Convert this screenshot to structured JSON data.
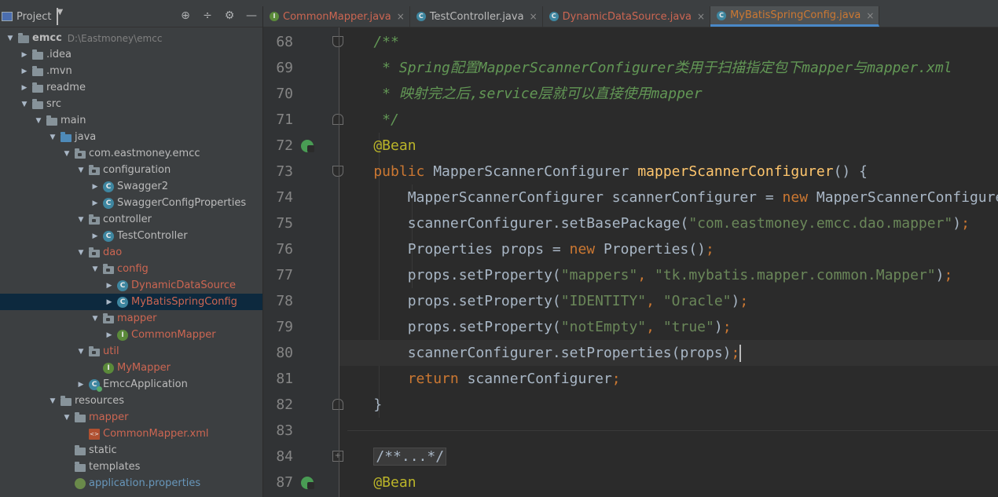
{
  "project_panel": {
    "title": "Project",
    "tree": [
      {
        "label": "emcc",
        "path": "D:\\Eastmoney\\emcc",
        "depth": 0,
        "expanded": true,
        "icon": "folder-icon",
        "kind": "root"
      },
      {
        "label": ".idea",
        "depth": 1,
        "expanded": false,
        "icon": "folder-icon"
      },
      {
        "label": ".mvn",
        "depth": 1,
        "expanded": false,
        "icon": "folder-icon"
      },
      {
        "label": "readme",
        "depth": 1,
        "expanded": false,
        "icon": "folder-icon"
      },
      {
        "label": "src",
        "depth": 1,
        "expanded": true,
        "icon": "folder-icon"
      },
      {
        "label": "main",
        "depth": 2,
        "expanded": true,
        "icon": "folder-icon"
      },
      {
        "label": "java",
        "depth": 3,
        "expanded": true,
        "icon": "source-folder-icon"
      },
      {
        "label": "com.eastmoney.emcc",
        "depth": 4,
        "expanded": true,
        "icon": "package-icon"
      },
      {
        "label": "configuration",
        "depth": 5,
        "expanded": true,
        "icon": "package-icon"
      },
      {
        "label": "Swagger2",
        "depth": 6,
        "expanded": false,
        "icon": "class-icon"
      },
      {
        "label": "SwaggerConfigProperties",
        "depth": 6,
        "expanded": false,
        "icon": "class-icon"
      },
      {
        "label": "controller",
        "depth": 5,
        "expanded": true,
        "icon": "package-icon"
      },
      {
        "label": "TestController",
        "depth": 6,
        "expanded": false,
        "icon": "class-icon"
      },
      {
        "label": "dao",
        "depth": 5,
        "expanded": true,
        "icon": "package-icon",
        "color": "red"
      },
      {
        "label": "config",
        "depth": 6,
        "expanded": true,
        "icon": "package-icon",
        "color": "red"
      },
      {
        "label": "DynamicDataSource",
        "depth": 7,
        "expanded": false,
        "icon": "class-icon",
        "color": "red"
      },
      {
        "label": "MyBatisSpringConfig",
        "depth": 7,
        "expanded": false,
        "icon": "class-icon",
        "color": "red",
        "selected": true
      },
      {
        "label": "mapper",
        "depth": 6,
        "expanded": true,
        "icon": "package-icon",
        "color": "red"
      },
      {
        "label": "CommonMapper",
        "depth": 7,
        "expanded": false,
        "icon": "interface-icon",
        "color": "red"
      },
      {
        "label": "util",
        "depth": 5,
        "expanded": true,
        "icon": "package-icon",
        "color": "red"
      },
      {
        "label": "MyMapper",
        "depth": 6,
        "expanded": null,
        "icon": "interface-icon",
        "color": "red"
      },
      {
        "label": "EmccApplication",
        "depth": 5,
        "expanded": false,
        "icon": "spring-app-icon"
      },
      {
        "label": "resources",
        "depth": 3,
        "expanded": true,
        "icon": "resources-folder-icon"
      },
      {
        "label": "mapper",
        "depth": 4,
        "expanded": true,
        "icon": "folder-icon",
        "color": "red"
      },
      {
        "label": "CommonMapper.xml",
        "depth": 5,
        "expanded": null,
        "icon": "xml-file-icon",
        "color": "red"
      },
      {
        "label": "static",
        "depth": 4,
        "expanded": null,
        "icon": "folder-icon"
      },
      {
        "label": "templates",
        "depth": 4,
        "expanded": null,
        "icon": "folder-icon"
      },
      {
        "label": "application.properties",
        "depth": 4,
        "expanded": null,
        "icon": "properties-file-icon",
        "color": "blue"
      }
    ]
  },
  "tabs": [
    {
      "label": "CommonMapper.java",
      "icon": "I",
      "color": "red",
      "active": false
    },
    {
      "label": "TestController.java",
      "icon": "C",
      "color": "default",
      "active": false
    },
    {
      "label": "DynamicDataSource.java",
      "icon": "C",
      "color": "red",
      "active": false
    },
    {
      "label": "MyBatisSpringConfig.java",
      "icon": "C",
      "color": "red",
      "active": true
    }
  ],
  "code_lines": [
    {
      "num": "68",
      "fold": "top",
      "tokens": [
        [
          "cmt",
          "    /**"
        ]
      ]
    },
    {
      "num": "69",
      "tokens": [
        [
          "cmt",
          "     * Spring配置MapperScannerConfigurer类用于扫描指定包下mapper与mapper.xml"
        ]
      ]
    },
    {
      "num": "70",
      "tokens": [
        [
          "cmt",
          "     * 映射完之后,service层就可以直接使用mapper"
        ]
      ]
    },
    {
      "num": "71",
      "fold": "bot",
      "tokens": [
        [
          "cmt",
          "     */"
        ]
      ]
    },
    {
      "num": "72",
      "marker": true,
      "tokens": [
        [
          "ann",
          "    @Bean"
        ]
      ]
    },
    {
      "num": "73",
      "fold": "top",
      "tokens": [
        [
          "kw",
          "    public "
        ],
        [
          "",
          "MapperScannerConfigurer "
        ],
        [
          "fn",
          "mapperScannerConfigurer"
        ],
        [
          "",
          "() {"
        ]
      ]
    },
    {
      "num": "74",
      "tokens": [
        [
          "",
          "        MapperScannerConfigurer scannerConfigurer = "
        ],
        [
          "kw",
          "new "
        ],
        [
          "",
          "MapperScannerConfigurer();"
        ]
      ]
    },
    {
      "num": "75",
      "tokens": [
        [
          "",
          "        scannerConfigurer.setBasePackage("
        ],
        [
          "str",
          "\"com.eastmoney.emcc.dao.mapper\""
        ],
        [
          "",
          ")"
        ],
        [
          "semi",
          ";"
        ]
      ]
    },
    {
      "num": "76",
      "tokens": [
        [
          "",
          "        Properties props = "
        ],
        [
          "kw",
          "new "
        ],
        [
          "",
          "Properties()"
        ],
        [
          "semi",
          ";"
        ]
      ]
    },
    {
      "num": "77",
      "tokens": [
        [
          "",
          "        props.setProperty("
        ],
        [
          "str",
          "\"mappers\""
        ],
        [
          "semi",
          ", "
        ],
        [
          "str",
          "\"tk.mybatis.mapper.common.Mapper\""
        ],
        [
          "",
          ")"
        ],
        [
          "semi",
          ";"
        ]
      ]
    },
    {
      "num": "78",
      "tokens": [
        [
          "",
          "        props.setProperty("
        ],
        [
          "str",
          "\"IDENTITY\""
        ],
        [
          "semi",
          ", "
        ],
        [
          "str",
          "\"Oracle\""
        ],
        [
          "",
          ")"
        ],
        [
          "semi",
          ";"
        ]
      ]
    },
    {
      "num": "79",
      "tokens": [
        [
          "",
          "        props.setProperty("
        ],
        [
          "str",
          "\"notEmpty\""
        ],
        [
          "semi",
          ", "
        ],
        [
          "str",
          "\"true\""
        ],
        [
          "",
          ")"
        ],
        [
          "semi",
          ";"
        ]
      ]
    },
    {
      "num": "80",
      "current": true,
      "tokens": [
        [
          "",
          "        scannerConfigurer.setProperties(props)"
        ],
        [
          "semi",
          ";"
        ],
        [
          "caret",
          ""
        ]
      ]
    },
    {
      "num": "81",
      "tokens": [
        [
          "kw",
          "        return "
        ],
        [
          "",
          "scannerConfigurer"
        ],
        [
          "semi",
          ";"
        ]
      ]
    },
    {
      "num": "82",
      "fold": "bot",
      "tokens": [
        [
          "",
          "    }"
        ]
      ]
    },
    {
      "num": "83",
      "tokens": []
    },
    {
      "num": "84",
      "fold": "plus",
      "tokens": [
        [
          "",
          "    "
        ],
        [
          "foldtxt",
          "/**...*/"
        ]
      ]
    },
    {
      "num": "87",
      "marker": true,
      "tokens": [
        [
          "ann",
          "    @Bean"
        ]
      ]
    }
  ]
}
